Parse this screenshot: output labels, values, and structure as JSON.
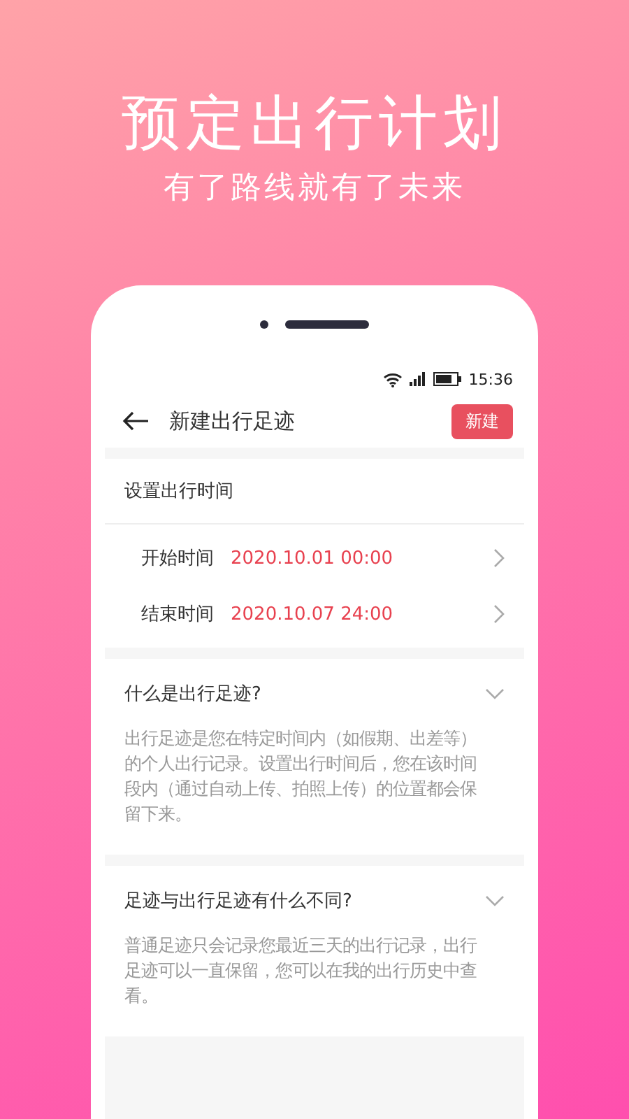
{
  "headline": "预定出行计划",
  "subtitle": "有了路线就有了未来",
  "status_bar": {
    "time": "15:36"
  },
  "header": {
    "title": "新建出行足迹",
    "action": "新建"
  },
  "time_section": {
    "title": "设置出行时间",
    "rows": [
      {
        "label": "开始时间",
        "value": "2020.10.01 00:00"
      },
      {
        "label": "结束时间",
        "value": "2020.10.07 24:00"
      }
    ]
  },
  "faq": [
    {
      "question": "什么是出行足迹?",
      "answer": "出行足迹是您在特定时间内（如假期、出差等）的个人出行记录。设置出行时间后，您在该时间段内（通过自动上传、拍照上传）的位置都会保留下来。",
      "expanded": true
    },
    {
      "question": "足迹与出行足迹有什么不同?",
      "answer": "普通足迹只会记录您最近三天的出行记录，出行足迹可以一直保留，您可以在我的出行历史中查看。",
      "expanded": true
    }
  ]
}
